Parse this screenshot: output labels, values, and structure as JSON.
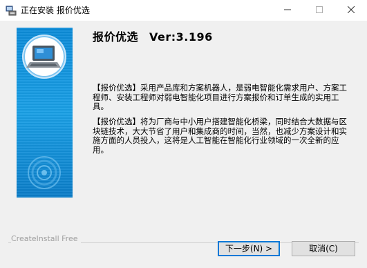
{
  "window": {
    "title": "正在安装 报价优选"
  },
  "header": {
    "product": "报价优选",
    "version": "Ver:3.196"
  },
  "body": {
    "paragraph1": "【报价优选】采用产品库和方案机器人，是弱电智能化需求用户、方案工程师、安装工程师对弱电智能化项目进行方案报价和订单生成的实用工具。",
    "paragraph2": "【报价优选】将为厂商与中小用户搭建智能化桥梁，同时结合大数据与区块链技术，大大节省了用户和集成商的时间，当然，也减少方案设计和实施方面的人员投入，这将是人工智能在智能化行业领域的一次全新的应用。"
  },
  "footer": {
    "brand": "CreateInstall Free",
    "next_label": "下一步(N) >",
    "cancel_label": "取消(C)"
  },
  "icons": {
    "app": "installer-app-icon",
    "minimize": "minimize-icon",
    "maximize": "maximize-icon",
    "close": "close-icon",
    "laptop": "laptop-icon",
    "disc": "disc-icon"
  },
  "colors": {
    "side_panel": "#0c8bd8",
    "focus_border": "#0078d7"
  }
}
